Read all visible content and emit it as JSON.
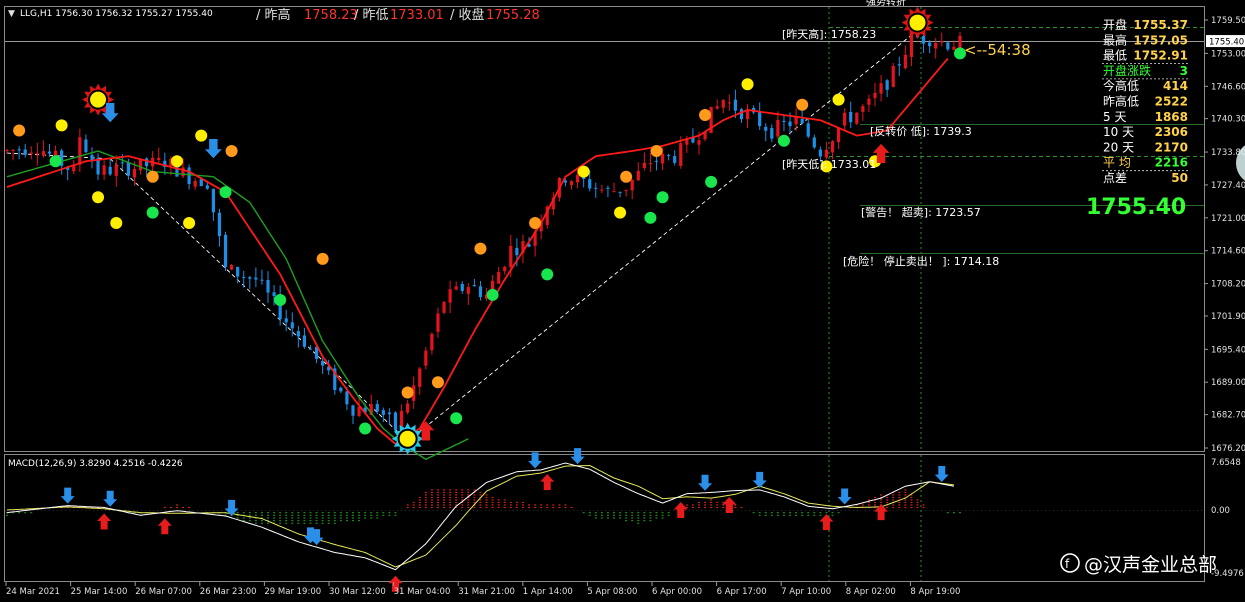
{
  "header": {
    "symbol_line": "LLG,H1  1756.30 1756.32 1755.27 1755.40",
    "prev_high_label": "/ 昨高",
    "prev_high_value": "1758.23",
    "prev_low_label": "/ 昨低",
    "prev_low_value": "1733.01",
    "close_label": "/ 收盘",
    "close_value": "1755.28"
  },
  "top_partial_label": "强势转折",
  "stats_panel": {
    "rows": [
      {
        "label": "开盘",
        "value": "1755.37",
        "color": "#ffd24a"
      },
      {
        "label": "最高",
        "value": "1757.05",
        "color": "#ffd24a"
      },
      {
        "label": "最低",
        "value": "1752.91",
        "color": "#ffd24a"
      },
      {
        "label": "开盘涨跌",
        "value": "3",
        "color": "#33ff33"
      },
      {
        "label": "今高低",
        "value": "414",
        "color": "#ffd24a"
      },
      {
        "label": "昨高低",
        "value": "2522",
        "color": "#ffd24a"
      },
      {
        "label": "5    天",
        "value": "1868",
        "color": "#ffd24a"
      },
      {
        "label": "10  天",
        "value": "2306",
        "color": "#ffd24a"
      },
      {
        "label": "20  天",
        "value": "2170",
        "color": "#ffd24a"
      },
      {
        "label": "平   均",
        "value": "2216",
        "color": "#33ff33"
      },
      {
        "label": "点差",
        "value": "50",
        "color": "#ffd24a"
      }
    ],
    "big_price": "1755.40"
  },
  "annotations": {
    "countdown": "<--54:38",
    "prev_high": "[昨天高]: 1758.23",
    "reversal": "[反转价 低]: 1739.3",
    "prev_low": "[昨天低]: 1733.01",
    "warning": "[警告！ 超卖]: 1723.57",
    "danger": "[危险！ 停止卖出！ ]: 1714.18"
  },
  "macd": {
    "label": "MACD(12,26,9) 3.8290 4.2516 -0.4226",
    "axis_labels": [
      "7.6548",
      "0.00",
      "-9.4976"
    ]
  },
  "watermark": "@汉声金业总部",
  "colors": {
    "background": "#000000",
    "bull": "#e3141e",
    "bear": "#1e8fe6",
    "ma_fast": "#ff1a1a",
    "ma_slow": "#1fa01f",
    "dot_green": "#18e64c",
    "dot_yellow": "#ffee00",
    "dot_orange": "#ff9a1a"
  },
  "chart_data": {
    "type": "candlestick",
    "symbol": "LLG",
    "timeframe": "H1",
    "price_axis": {
      "ticks": [
        1759.5,
        1753.0,
        1746.6,
        1740.3,
        1733.8,
        1727.4,
        1721.0,
        1714.6,
        1708.2,
        1701.9,
        1695.4,
        1689.0,
        1682.7,
        1676.2
      ],
      "labels": [
        "1759.50",
        "1753.00",
        "1746.60",
        "1740.30",
        "1733.80",
        "1727.40",
        "1721.00",
        "1714.60",
        "1708.20",
        "1701.90",
        "1695.40",
        "1689.00",
        "1682.70",
        "1676.20"
      ],
      "current_label": "1755.40",
      "ylim": [
        1675.0,
        1763.0
      ]
    },
    "time_axis_labels": [
      "24 Mar 2021",
      "25 Mar 14:00",
      "26 Mar 07:00",
      "26 Mar 23:00",
      "29 Mar 19:00",
      "30 Mar 12:00",
      "31 Mar 04:00",
      "31 Mar 21:00",
      "1 Apr 14:00",
      "5 Apr 08:00",
      "6 Apr 00:00",
      "6 Apr 17:00",
      "7 Apr 10:00",
      "8 Apr 02:00",
      "8 Apr 19:00"
    ],
    "price_waypoints": [
      [
        0,
        1734
      ],
      [
        5,
        1735
      ],
      [
        11,
        1730
      ],
      [
        12,
        1737
      ],
      [
        15,
        1730
      ],
      [
        22,
        1731
      ],
      [
        26,
        1732
      ],
      [
        30,
        1729
      ],
      [
        33,
        1728
      ],
      [
        36,
        1711
      ],
      [
        41,
        1709
      ],
      [
        46,
        1701
      ],
      [
        49,
        1697
      ],
      [
        53,
        1690
      ],
      [
        57,
        1684
      ],
      [
        61,
        1684
      ],
      [
        64,
        1680
      ],
      [
        67,
        1688
      ],
      [
        72,
        1705
      ],
      [
        76,
        1708
      ],
      [
        79,
        1706
      ],
      [
        83,
        1715
      ],
      [
        86,
        1716
      ],
      [
        89,
        1724
      ],
      [
        92,
        1729
      ],
      [
        95,
        1728
      ],
      [
        99,
        1726
      ],
      [
        102,
        1727
      ],
      [
        106,
        1732
      ],
      [
        110,
        1733
      ],
      [
        113,
        1736
      ],
      [
        116,
        1741
      ],
      [
        118,
        1744
      ],
      [
        122,
        1741
      ],
      [
        126,
        1738
      ],
      [
        130,
        1740
      ],
      [
        134,
        1734
      ],
      [
        138,
        1740
      ],
      [
        142,
        1743
      ],
      [
        146,
        1749
      ],
      [
        149,
        1756
      ],
      [
        152,
        1756
      ],
      [
        155,
        1755
      ]
    ],
    "ma_fast_waypoints": [
      [
        0,
        1727
      ],
      [
        13,
        1732
      ],
      [
        20,
        1733
      ],
      [
        30,
        1730
      ],
      [
        36,
        1726
      ],
      [
        45,
        1710
      ],
      [
        52,
        1694
      ],
      [
        57,
        1686
      ],
      [
        61,
        1680
      ],
      [
        64,
        1677
      ],
      [
        68,
        1680
      ],
      [
        72,
        1688
      ],
      [
        77,
        1699
      ],
      [
        82,
        1709
      ],
      [
        88,
        1720
      ],
      [
        92,
        1729
      ],
      [
        97,
        1733
      ],
      [
        103,
        1734
      ],
      [
        108,
        1735
      ],
      [
        114,
        1737
      ],
      [
        118,
        1740
      ],
      [
        122,
        1742
      ],
      [
        128,
        1741
      ],
      [
        134,
        1740
      ],
      [
        140,
        1737
      ],
      [
        145,
        1738
      ],
      [
        150,
        1745
      ],
      [
        155,
        1752
      ]
    ],
    "ma_slow_waypoints": [
      [
        0,
        1729
      ],
      [
        15,
        1734
      ],
      [
        24,
        1730
      ],
      [
        34,
        1729
      ],
      [
        40,
        1724
      ],
      [
        46,
        1713
      ],
      [
        52,
        1697
      ],
      [
        58,
        1686
      ],
      [
        62,
        1680
      ],
      [
        65,
        1677
      ],
      [
        69,
        1674
      ],
      [
        76,
        1678
      ]
    ],
    "reference_lines": [
      {
        "name": "prev_high",
        "value": 1758.23
      },
      {
        "name": "current",
        "value": 1755.4
      },
      {
        "name": "reversal",
        "value": 1739.3
      },
      {
        "name": "prev_low",
        "value": 1733.01
      },
      {
        "name": "oversold",
        "value": 1723.57
      },
      {
        "name": "danger",
        "value": 1714.18
      }
    ],
    "signal_markers": [
      {
        "type": "starburst",
        "bar": 15,
        "price": 1744
      },
      {
        "type": "starburst",
        "bar": 150,
        "price": 1759
      },
      {
        "type": "starburst_blue",
        "bar": 66,
        "price": 1678
      }
    ],
    "dots": [
      {
        "color": "orange",
        "bar": 2,
        "price": 1738
      },
      {
        "color": "yellow",
        "bar": 9,
        "price": 1739
      },
      {
        "color": "green",
        "bar": 8,
        "price": 1732
      },
      {
        "color": "yellow",
        "bar": 15,
        "price": 1725
      },
      {
        "color": "yellow",
        "bar": 18,
        "price": 1720
      },
      {
        "color": "orange",
        "bar": 24,
        "price": 1729
      },
      {
        "color": "yellow",
        "bar": 28,
        "price": 1732
      },
      {
        "color": "green",
        "bar": 24,
        "price": 1722
      },
      {
        "color": "yellow",
        "bar": 30,
        "price": 1720
      },
      {
        "color": "yellow",
        "bar": 32,
        "price": 1737
      },
      {
        "color": "orange",
        "bar": 37,
        "price": 1734
      },
      {
        "color": "green",
        "bar": 36,
        "price": 1726
      },
      {
        "color": "green",
        "bar": 45,
        "price": 1705
      },
      {
        "color": "orange",
        "bar": 52,
        "price": 1713
      },
      {
        "color": "green",
        "bar": 59,
        "price": 1680
      },
      {
        "color": "orange",
        "bar": 66,
        "price": 1687
      },
      {
        "color": "orange",
        "bar": 71,
        "price": 1689
      },
      {
        "color": "green",
        "bar": 74,
        "price": 1682
      },
      {
        "color": "orange",
        "bar": 78,
        "price": 1715
      },
      {
        "color": "green",
        "bar": 80,
        "price": 1706
      },
      {
        "color": "orange",
        "bar": 87,
        "price": 1720
      },
      {
        "color": "green",
        "bar": 89,
        "price": 1710
      },
      {
        "color": "yellow",
        "bar": 95,
        "price": 1730
      },
      {
        "color": "orange",
        "bar": 102,
        "price": 1729
      },
      {
        "color": "yellow",
        "bar": 101,
        "price": 1722
      },
      {
        "color": "green",
        "bar": 106,
        "price": 1721
      },
      {
        "color": "orange",
        "bar": 107,
        "price": 1734
      },
      {
        "color": "green",
        "bar": 108,
        "price": 1725
      },
      {
        "color": "green",
        "bar": 116,
        "price": 1728
      },
      {
        "color": "orange",
        "bar": 115,
        "price": 1741
      },
      {
        "color": "yellow",
        "bar": 122,
        "price": 1747
      },
      {
        "color": "green",
        "bar": 128,
        "price": 1736
      },
      {
        "color": "orange",
        "bar": 131,
        "price": 1743
      },
      {
        "color": "yellow",
        "bar": 137,
        "price": 1744
      },
      {
        "color": "yellow",
        "bar": 135,
        "price": 1731
      },
      {
        "color": "yellow",
        "bar": 143,
        "price": 1732
      },
      {
        "color": "green",
        "bar": 157,
        "price": 1753
      }
    ],
    "arrows": [
      {
        "dir": "down",
        "bar": 17,
        "price": 1741
      },
      {
        "dir": "down",
        "bar": 34,
        "price": 1734
      },
      {
        "dir": "up",
        "bar": 69,
        "price": 1680
      },
      {
        "dir": "up",
        "bar": 144,
        "price": 1734
      }
    ],
    "macd_series": {
      "signal": [
        [
          0,
          0.0
        ],
        [
          10,
          0.5
        ],
        [
          16,
          0.2
        ],
        [
          22,
          -0.4
        ],
        [
          28,
          -0.5
        ],
        [
          36,
          -0.4
        ],
        [
          42,
          -1.3
        ],
        [
          48,
          -3.6
        ],
        [
          54,
          -5.2
        ],
        [
          59,
          -6.4
        ],
        [
          64,
          -8.6
        ],
        [
          69,
          -6.8
        ],
        [
          74,
          -2.3
        ],
        [
          79,
          3.0
        ],
        [
          84,
          5.4
        ],
        [
          88,
          5.9
        ],
        [
          92,
          7.0
        ],
        [
          96,
          7.1
        ],
        [
          100,
          5.1
        ],
        [
          104,
          3.8
        ],
        [
          108,
          1.8
        ],
        [
          112,
          2.1
        ],
        [
          116,
          1.9
        ],
        [
          120,
          2.5
        ],
        [
          124,
          3.8
        ],
        [
          128,
          2.6
        ],
        [
          132,
          1.1
        ],
        [
          136,
          0.6
        ],
        [
          140,
          0.4
        ],
        [
          144,
          0.5
        ],
        [
          148,
          1.9
        ],
        [
          152,
          4.5
        ],
        [
          156,
          4.0
        ]
      ],
      "main": [
        [
          0,
          -0.4
        ],
        [
          10,
          0.7
        ],
        [
          16,
          0.4
        ],
        [
          22,
          -0.8
        ],
        [
          28,
          -0.1
        ],
        [
          36,
          -0.9
        ],
        [
          42,
          -2.6
        ],
        [
          48,
          -4.8
        ],
        [
          54,
          -6.4
        ],
        [
          59,
          -7.2
        ],
        [
          64,
          -9.0
        ],
        [
          69,
          -5.1
        ],
        [
          74,
          0.6
        ],
        [
          79,
          4.4
        ],
        [
          84,
          6.1
        ],
        [
          88,
          6.4
        ],
        [
          92,
          7.5
        ],
        [
          96,
          6.5
        ],
        [
          100,
          4.4
        ],
        [
          104,
          2.6
        ],
        [
          108,
          1.1
        ],
        [
          112,
          2.6
        ],
        [
          116,
          2.8
        ],
        [
          120,
          3.1
        ],
        [
          124,
          3.2
        ],
        [
          128,
          2.1
        ],
        [
          132,
          0.6
        ],
        [
          136,
          0.2
        ],
        [
          140,
          0.9
        ],
        [
          144,
          1.9
        ],
        [
          148,
          3.8
        ],
        [
          152,
          4.5
        ],
        [
          156,
          3.8
        ]
      ],
      "arrows": [
        {
          "dir": "down",
          "bar": 10
        },
        {
          "dir": "up",
          "bar": 16
        },
        {
          "dir": "down",
          "bar": 17
        },
        {
          "dir": "up",
          "bar": 26
        },
        {
          "dir": "down",
          "bar": 37
        },
        {
          "dir": "down",
          "bar": 50
        },
        {
          "dir": "down",
          "bar": 51
        },
        {
          "dir": "up",
          "bar": 64
        },
        {
          "dir": "down",
          "bar": 87
        },
        {
          "dir": "up",
          "bar": 89
        },
        {
          "dir": "down",
          "bar": 94
        },
        {
          "dir": "up",
          "bar": 111
        },
        {
          "dir": "down",
          "bar": 115
        },
        {
          "dir": "up",
          "bar": 119
        },
        {
          "dir": "down",
          "bar": 124
        },
        {
          "dir": "up",
          "bar": 135
        },
        {
          "dir": "down",
          "bar": 138
        },
        {
          "dir": "up",
          "bar": 144
        },
        {
          "dir": "down",
          "bar": 154
        }
      ]
    }
  }
}
